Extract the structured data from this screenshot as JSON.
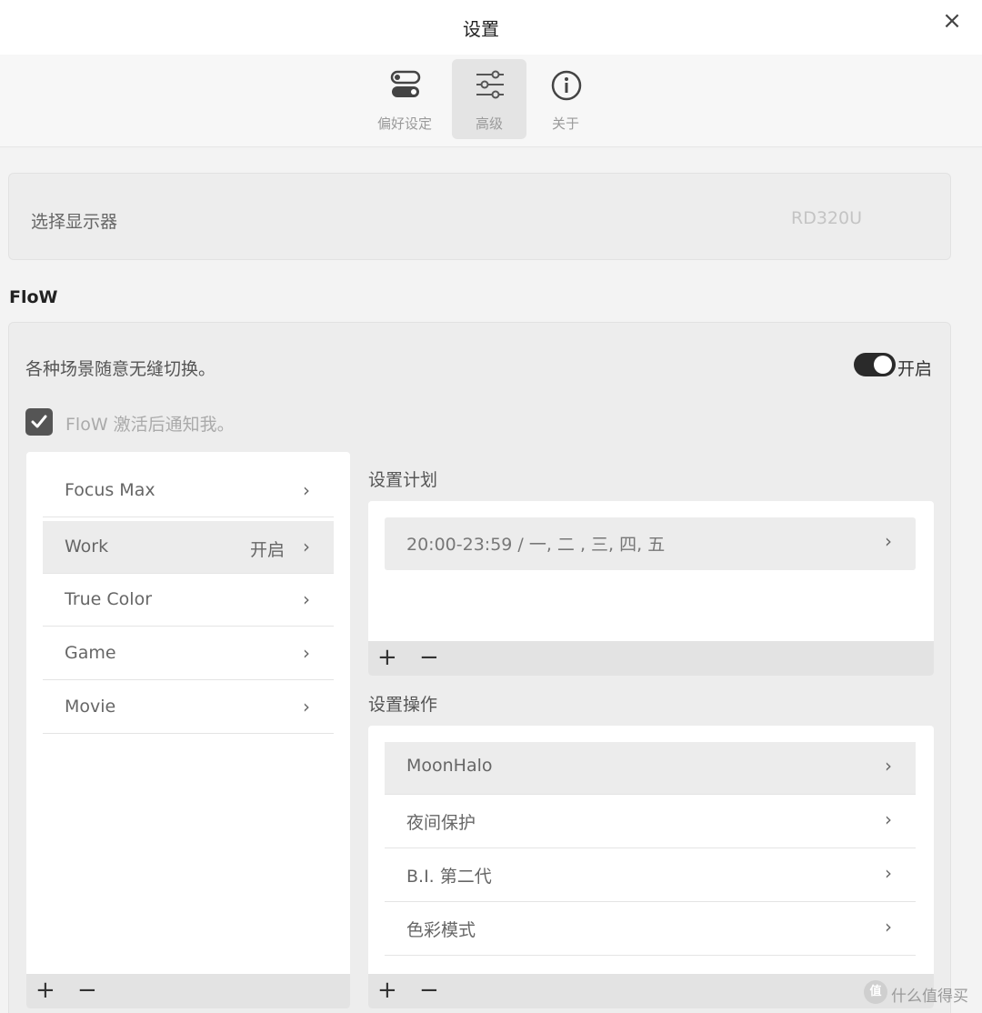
{
  "window": {
    "title": "设置",
    "close_icon": "×"
  },
  "tabs": [
    {
      "label": "偏好设定",
      "icon": "toggle-icon",
      "active": false
    },
    {
      "label": "高级",
      "icon": "sliders-icon",
      "active": true
    },
    {
      "label": "关于",
      "icon": "info-icon",
      "active": false
    }
  ],
  "display": {
    "label": "选择显示器",
    "value": "RD320U"
  },
  "flow": {
    "section_title": "FloW",
    "description": "各种场景随意无缝切换。",
    "toggle_label": "开启",
    "toggle_on": true,
    "notify_label": "FloW 激活后通知我。",
    "notify_checked": true
  },
  "scenes": {
    "items": [
      {
        "name": "Focus Max",
        "status": "",
        "selected": false
      },
      {
        "name": "Work",
        "status": "开启",
        "selected": true
      },
      {
        "name": "True Color",
        "status": "",
        "selected": false
      },
      {
        "name": "Game",
        "status": "",
        "selected": false
      },
      {
        "name": "Movie",
        "status": "",
        "selected": false
      }
    ],
    "add": "+",
    "remove": "−"
  },
  "plan": {
    "title": "设置计划",
    "items": [
      {
        "text": "20:00-23:59  / 一, 二 , 三, 四, 五"
      }
    ],
    "add": "+",
    "remove": "−"
  },
  "actions": {
    "title": "设置操作",
    "items": [
      {
        "name": "MoonHalo",
        "selected": true
      },
      {
        "name": "夜间保护",
        "selected": false
      },
      {
        "name": "B.I. 第二代",
        "selected": false
      },
      {
        "name": "色彩模式",
        "selected": false
      }
    ],
    "add": "+",
    "remove": "−"
  },
  "chevron": "›",
  "watermark": {
    "logo": "值",
    "text": "什么值得买"
  },
  "colors": {
    "toggle_on": "#2a2a2a",
    "selected_row": "#ececec",
    "panel_bg": "#ededed"
  }
}
